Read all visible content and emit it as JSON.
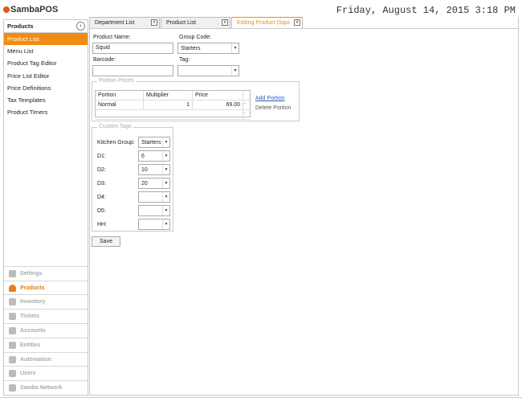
{
  "app": {
    "logo_text": "SambaPOS",
    "datetime": "Friday, August 14, 2015 3:18 PM"
  },
  "sidebar": {
    "header": "Products",
    "items": [
      "Product List",
      "Menu List",
      "Product Tag Editor",
      "Price List Editor",
      "Price Definitions",
      "Tax Templates",
      "Product Timers"
    ],
    "modules": [
      "Settings",
      "Products",
      "Inventory",
      "Tickets",
      "Accounts",
      "Entities",
      "Automation",
      "Users",
      "Samba Network"
    ]
  },
  "tabs": [
    {
      "label": "Department List",
      "close": "x"
    },
    {
      "label": "Product List",
      "close": "x"
    },
    {
      "label": "Editing Product (Squi",
      "close": "x"
    }
  ],
  "form": {
    "product_name_label": "Product Name:",
    "product_name_value": "Squid",
    "group_code_label": "Group Code:",
    "group_code_value": "Starters",
    "barcode_label": "Barcode:",
    "barcode_value": "",
    "tag_label": "Tag:",
    "tag_value": ""
  },
  "portion_prices": {
    "title": "Portion Prices",
    "columns": [
      "Portion",
      "Multiplier",
      "Price"
    ],
    "rows": [
      [
        "Normal",
        "1",
        "69.00"
      ]
    ],
    "add_portion": "Add Portion",
    "delete_portion": "Delete Portion"
  },
  "custom_tags": {
    "title": "Custom Tags",
    "rows": [
      {
        "label": "Kitchen Group:",
        "value": "Starters"
      },
      {
        "label": "D1:",
        "value": "6"
      },
      {
        "label": "D2:",
        "value": "10"
      },
      {
        "label": "D3:",
        "value": "20"
      },
      {
        "label": "D4:",
        "value": ""
      },
      {
        "label": "D5:",
        "value": ""
      },
      {
        "label": "HH:",
        "value": ""
      }
    ]
  },
  "save_label": "Save"
}
